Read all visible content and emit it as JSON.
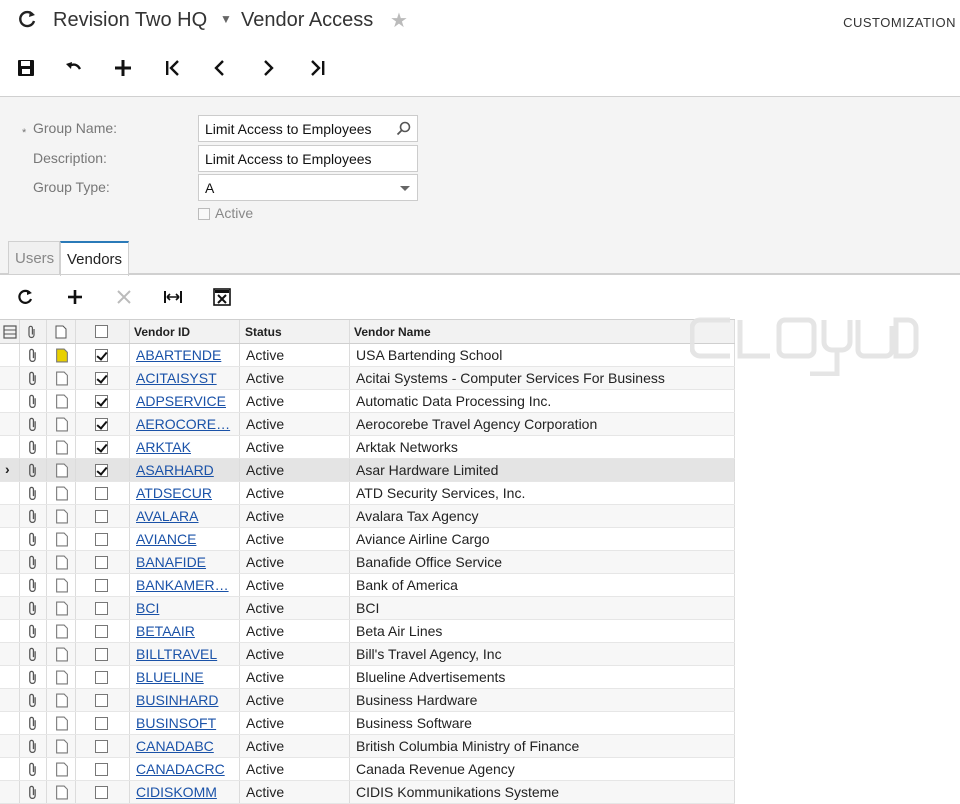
{
  "header": {
    "company": "Revision Two HQ",
    "screen_title": "Vendor Access",
    "customization": "CUSTOMIZATION"
  },
  "icons": {
    "refresh": "refresh-icon",
    "save": "save-icon",
    "undo": "undo-icon",
    "add": "plus-icon",
    "first": "first-record-icon",
    "prev": "previous-icon",
    "next": "next-icon",
    "last": "last-record-icon",
    "star": "star-icon",
    "search": "search-icon"
  },
  "form": {
    "group_name_label": "Group Name:",
    "group_name_value": "Limit Access to Employees",
    "description_label": "Description:",
    "description_value": "Limit Access to Employees",
    "group_type_label": "Group Type:",
    "group_type_value": "A",
    "active_label": "Active"
  },
  "tabs": [
    {
      "label": "Users"
    },
    {
      "label": "Vendors"
    }
  ],
  "grid": {
    "columns": {
      "vendor_id": "Vendor ID",
      "status": "Status",
      "vendor_name": "Vendor Name"
    },
    "rows": [
      {
        "vendor_id": "ABARTENDE",
        "status": "Active",
        "vendor_name": "USA Bartending School",
        "included": true,
        "has_note": true
      },
      {
        "vendor_id": "ACITAISYST",
        "status": "Active",
        "vendor_name": "Acitai Systems - Computer Services For Business",
        "included": true
      },
      {
        "vendor_id": "ADPSERVICE",
        "status": "Active",
        "vendor_name": "Automatic Data Processing Inc.",
        "included": true
      },
      {
        "vendor_id": "AEROCORE…",
        "status": "Active",
        "vendor_name": "Aerocorebe Travel Agency Corporation",
        "included": true
      },
      {
        "vendor_id": "ARKTAK",
        "status": "Active",
        "vendor_name": "Arktak Networks",
        "included": true
      },
      {
        "vendor_id": "ASARHARD",
        "status": "Active",
        "vendor_name": "Asar Hardware Limited",
        "included": true,
        "selected": true
      },
      {
        "vendor_id": "ATDSECUR",
        "status": "Active",
        "vendor_name": "ATD Security Services, Inc.",
        "included": false
      },
      {
        "vendor_id": "AVALARA",
        "status": "Active",
        "vendor_name": "Avalara Tax Agency",
        "included": false
      },
      {
        "vendor_id": "AVIANCE",
        "status": "Active",
        "vendor_name": "Aviance Airline Cargo",
        "included": false
      },
      {
        "vendor_id": "BANAFIDE",
        "status": "Active",
        "vendor_name": "Banafide Office Service",
        "included": false
      },
      {
        "vendor_id": "BANKAMER…",
        "status": "Active",
        "vendor_name": "Bank of America",
        "included": false
      },
      {
        "vendor_id": "BCI",
        "status": "Active",
        "vendor_name": "BCI",
        "included": false
      },
      {
        "vendor_id": "BETAAIR",
        "status": "Active",
        "vendor_name": "Beta Air Lines",
        "included": false
      },
      {
        "vendor_id": "BILLTRAVEL",
        "status": "Active",
        "vendor_name": "Bill's Travel Agency, Inc",
        "included": false
      },
      {
        "vendor_id": "BLUELINE",
        "status": "Active",
        "vendor_name": "Blueline Advertisements",
        "included": false
      },
      {
        "vendor_id": "BUSINHARD",
        "status": "Active",
        "vendor_name": "Business Hardware",
        "included": false
      },
      {
        "vendor_id": "BUSINSOFT",
        "status": "Active",
        "vendor_name": "Business Software",
        "included": false
      },
      {
        "vendor_id": "CANADABC",
        "status": "Active",
        "vendor_name": "British Columbia Ministry of Finance",
        "included": false
      },
      {
        "vendor_id": "CANADACRC",
        "status": "Active",
        "vendor_name": "Canada Revenue Agency",
        "included": false
      },
      {
        "vendor_id": "CIDISKOMM",
        "status": "Active",
        "vendor_name": "CIDIS Kommunikations Systeme",
        "included": false
      }
    ]
  },
  "colors": {
    "link": "#1a52a8",
    "tab_accent": "#2a7ab8",
    "form_bg": "#f4f4f4",
    "note_yellow": "#e8d000"
  }
}
